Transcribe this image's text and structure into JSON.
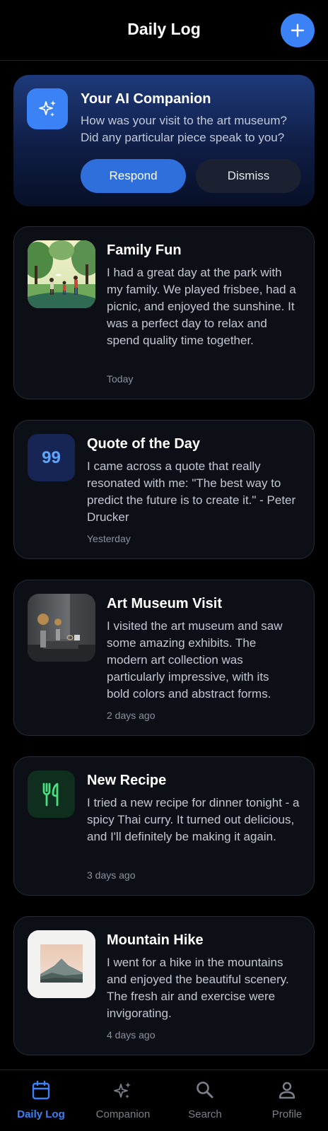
{
  "header": {
    "title": "Daily Log",
    "add_icon": "plus-icon"
  },
  "ai_card": {
    "icon": "sparkles-icon",
    "title": "Your AI Companion",
    "message": "How was your visit to the art museum? Did any particular piece speak to you?",
    "respond_label": "Respond",
    "dismiss_label": "Dismiss"
  },
  "entries": [
    {
      "title": "Family Fun",
      "text": "I had a great day at the park with my family. We played frisbee, had a picnic, and enjoyed the sunshine. It was a perfect day to relax and spend quality time together.",
      "time": "Today",
      "visual": "park-photo"
    },
    {
      "title": "Quote of the Day",
      "text": "I came across a quote that really resonated with me: \"The best way to predict the future is to create it.\" - Peter Drucker",
      "time": "Yesterday",
      "visual": "quote-icon",
      "glyph": "99"
    },
    {
      "title": "Art Museum Visit",
      "text": "I visited the art museum and saw some amazing exhibits. The modern art collection was particularly impressive, with its bold colors and abstract forms.",
      "time": "2 days ago",
      "visual": "museum-photo"
    },
    {
      "title": "New Recipe",
      "text": "I tried a new recipe for dinner tonight - a spicy Thai curry. It turned out delicious, and I'll definitely be making it again.",
      "time": "3 days ago",
      "visual": "utensils-icon"
    },
    {
      "title": "Mountain Hike",
      "text": "I went for a hike in the mountains and enjoyed the beautiful scenery. The fresh air and exercise were invigorating.",
      "time": "4 days ago",
      "visual": "mountain-photo"
    }
  ],
  "nav": [
    {
      "label": "Daily Log",
      "icon": "calendar-icon",
      "active": true
    },
    {
      "label": "Companion",
      "icon": "sparkles-icon",
      "active": false
    },
    {
      "label": "Search",
      "icon": "search-icon",
      "active": false
    },
    {
      "label": "Profile",
      "icon": "user-icon",
      "active": false
    }
  ],
  "colors": {
    "accent": "#3b82f6",
    "background": "#000000",
    "card": "#0c0f16",
    "quote_icon_bg": "#172554",
    "recipe_icon_bg": "#0f2e1d",
    "recipe_icon_fg": "#4ade80"
  }
}
